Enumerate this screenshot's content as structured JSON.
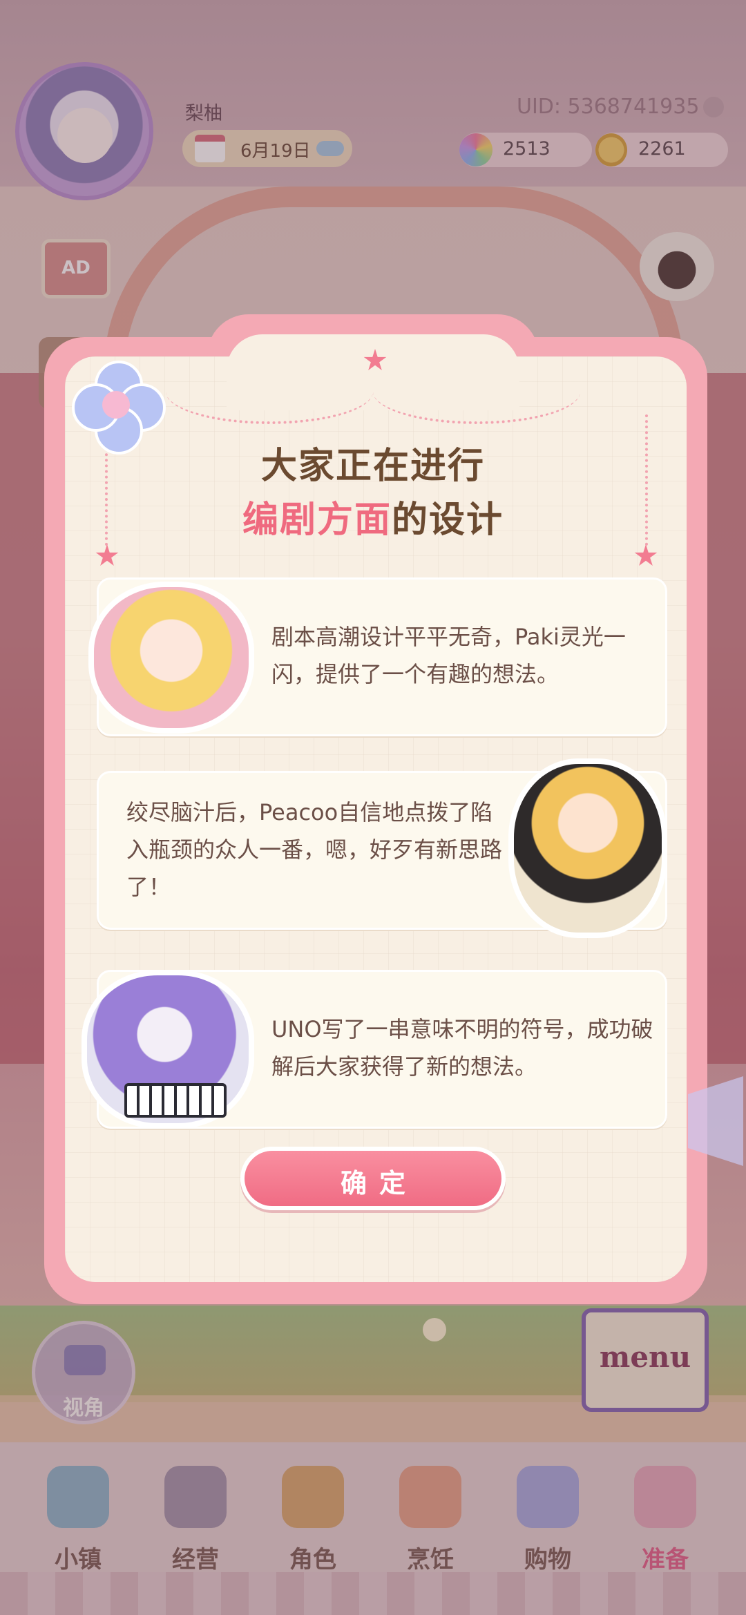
{
  "hud": {
    "username": "梨柚",
    "uid": "UID: 5368741935",
    "date": "6月19日",
    "gems": "2513",
    "coins": "2261",
    "ad_label": "AD"
  },
  "dialog": {
    "title_line1": "大家正在进行",
    "title_highlight": "编剧方面",
    "title_rest": "的设计",
    "cards": [
      {
        "text": "剧本高潮设计平平无奇，Paki灵光一闪，提供了一个有趣的想法。"
      },
      {
        "text": "绞尽脑汁后，Peacoo自信地点拨了陷入瓶颈的众人一番，嗯，好歹有新思路了！"
      },
      {
        "text": "UNO写了一串意味不明的符号，成功破解后大家获得了新的想法。"
      }
    ],
    "confirm_label": "确定"
  },
  "controls": {
    "camera_label": "视角",
    "menu_label": "menu"
  },
  "nav": {
    "items": [
      {
        "label": "小镇",
        "icon": "map-icon",
        "color": "#7fb0c9"
      },
      {
        "label": "经营",
        "icon": "shop-bag-icon",
        "color": "#9a8aa3"
      },
      {
        "label": "角色",
        "icon": "character-icon",
        "color": "#d7a15b"
      },
      {
        "label": "烹饪",
        "icon": "sandwich-icon",
        "color": "#e69a7a"
      },
      {
        "label": "购物",
        "icon": "shopping-bag-icon",
        "color": "#9fa3e0"
      },
      {
        "label": "准备",
        "icon": "prepare-basket-icon",
        "color": "#e7a2b6"
      }
    ],
    "active_index": 5
  },
  "colors": {
    "accent_pink": "#ef6a7f",
    "dialog_frame": "#f4a9b4",
    "dialog_bg": "#f8efe3",
    "title_brown": "#6b4a30"
  }
}
